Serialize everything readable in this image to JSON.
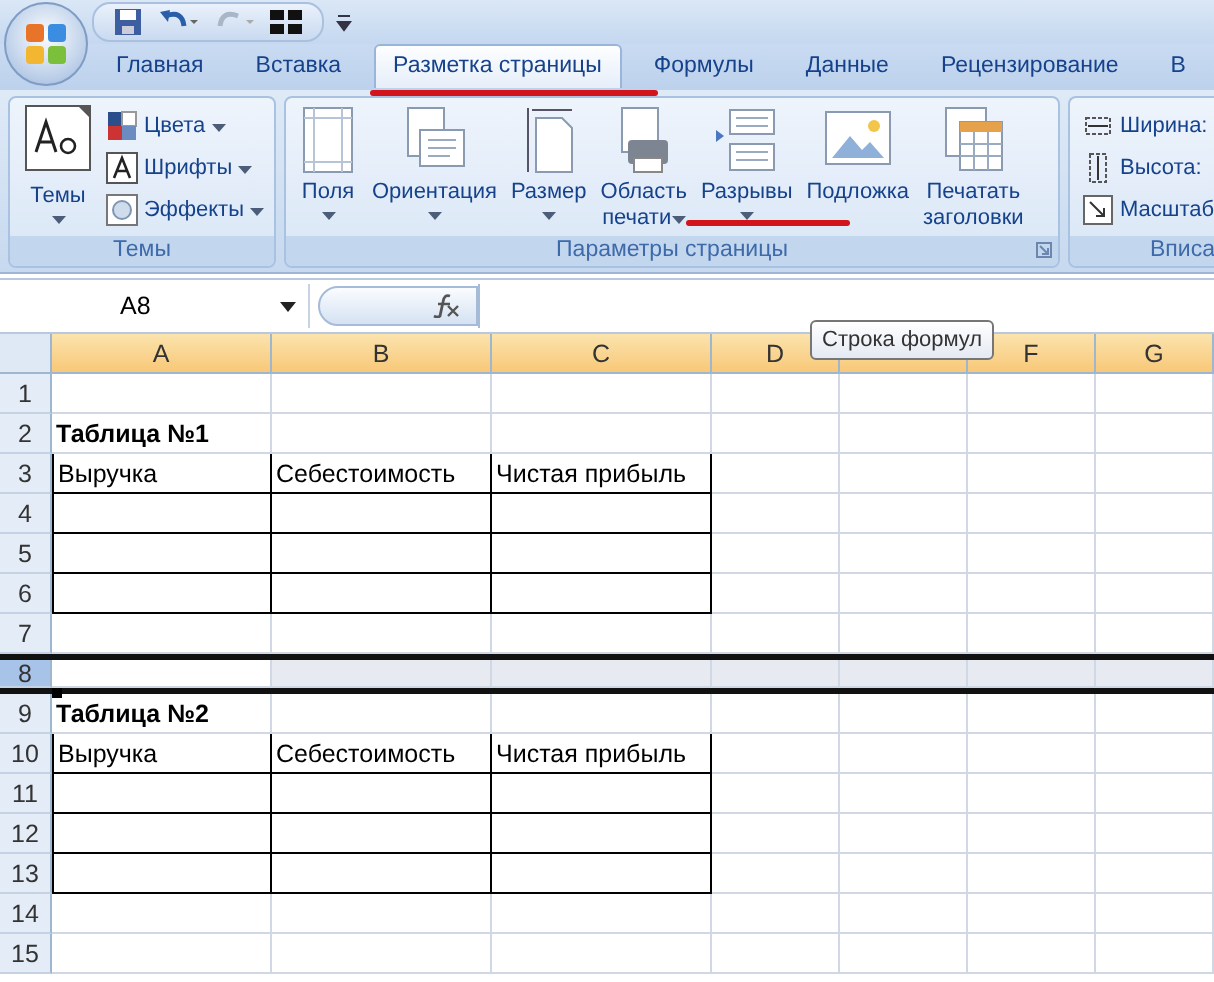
{
  "ribbon_tabs": [
    {
      "label": "Главная",
      "selected": false
    },
    {
      "label": "Вставка",
      "selected": false
    },
    {
      "label": "Разметка страницы",
      "selected": true
    },
    {
      "label": "Формулы",
      "selected": false
    },
    {
      "label": "Данные",
      "selected": false
    },
    {
      "label": "Рецензирование",
      "selected": false
    },
    {
      "label": "В",
      "selected": false
    }
  ],
  "ribbon_groups": [
    {
      "kind": "themes",
      "title": "Темы",
      "big_button": {
        "label": "Темы"
      },
      "items": [
        {
          "label": "Цвета"
        },
        {
          "label": "Шрифты"
        },
        {
          "label": "Эффекты"
        }
      ]
    },
    {
      "kind": "buttons",
      "title": "Параметры страницы",
      "launcher": true,
      "buttons": [
        {
          "lines": [
            "Поля"
          ],
          "has_menu": true,
          "annotated": false
        },
        {
          "lines": [
            "Ориентация"
          ],
          "has_menu": true,
          "annotated": false
        },
        {
          "lines": [
            "Размер"
          ],
          "has_menu": true,
          "annotated": false
        },
        {
          "lines": [
            "Область",
            "печати"
          ],
          "has_menu": true,
          "annotated": false
        },
        {
          "lines": [
            "Разрывы"
          ],
          "has_menu": true,
          "annotated": true
        },
        {
          "lines": [
            "Подложка"
          ],
          "has_menu": false,
          "annotated": false
        },
        {
          "lines": [
            "Печатать",
            "заголовки"
          ],
          "has_menu": false,
          "annotated": false
        }
      ]
    },
    {
      "kind": "list",
      "title": "Вписа",
      "items": [
        {
          "label": "Ширина:"
        },
        {
          "label": "Высота:"
        },
        {
          "label": "Масштаб"
        }
      ]
    }
  ],
  "formula_bar": {
    "name_box": "A8",
    "tooltip": "Строка формул"
  },
  "columns": [
    {
      "label": "A",
      "selected": true
    },
    {
      "label": "B",
      "selected": true
    },
    {
      "label": "C",
      "selected": true
    },
    {
      "label": "D",
      "selected": true
    },
    {
      "selected": true
    },
    {
      "label": "F",
      "selected": true
    },
    {
      "label": "G",
      "selected": true
    }
  ],
  "rows": [
    {
      "number": "1",
      "kind": "empty",
      "selected": false
    },
    {
      "number": "2",
      "kind": "title",
      "selected": false,
      "cells": [
        "Таблица №1"
      ]
    },
    {
      "number": "3",
      "kind": "table",
      "selected": false,
      "cells": [
        "Выручка",
        "Себестоимость",
        "Чистая прибыль"
      ]
    },
    {
      "number": "4",
      "kind": "table",
      "selected": false
    },
    {
      "number": "5",
      "kind": "table",
      "selected": false
    },
    {
      "number": "6",
      "kind": "table",
      "selected": false
    },
    {
      "number": "7",
      "kind": "empty",
      "selected": false
    },
    {
      "number": "8",
      "kind": "empty",
      "selected": true
    },
    {
      "number": "9",
      "kind": "title",
      "selected": false,
      "cells": [
        "Таблица №2"
      ]
    },
    {
      "number": "10",
      "kind": "table",
      "selected": false,
      "cells": [
        "Выручка",
        "Себестоимость",
        "Чистая прибыль"
      ]
    },
    {
      "number": "11",
      "kind": "table",
      "selected": false
    },
    {
      "number": "12",
      "kind": "table",
      "selected": false
    },
    {
      "number": "13",
      "kind": "table",
      "selected": false
    },
    {
      "number": "14",
      "kind": "empty",
      "selected": false
    },
    {
      "number": "15",
      "kind": "empty",
      "selected": false
    }
  ]
}
